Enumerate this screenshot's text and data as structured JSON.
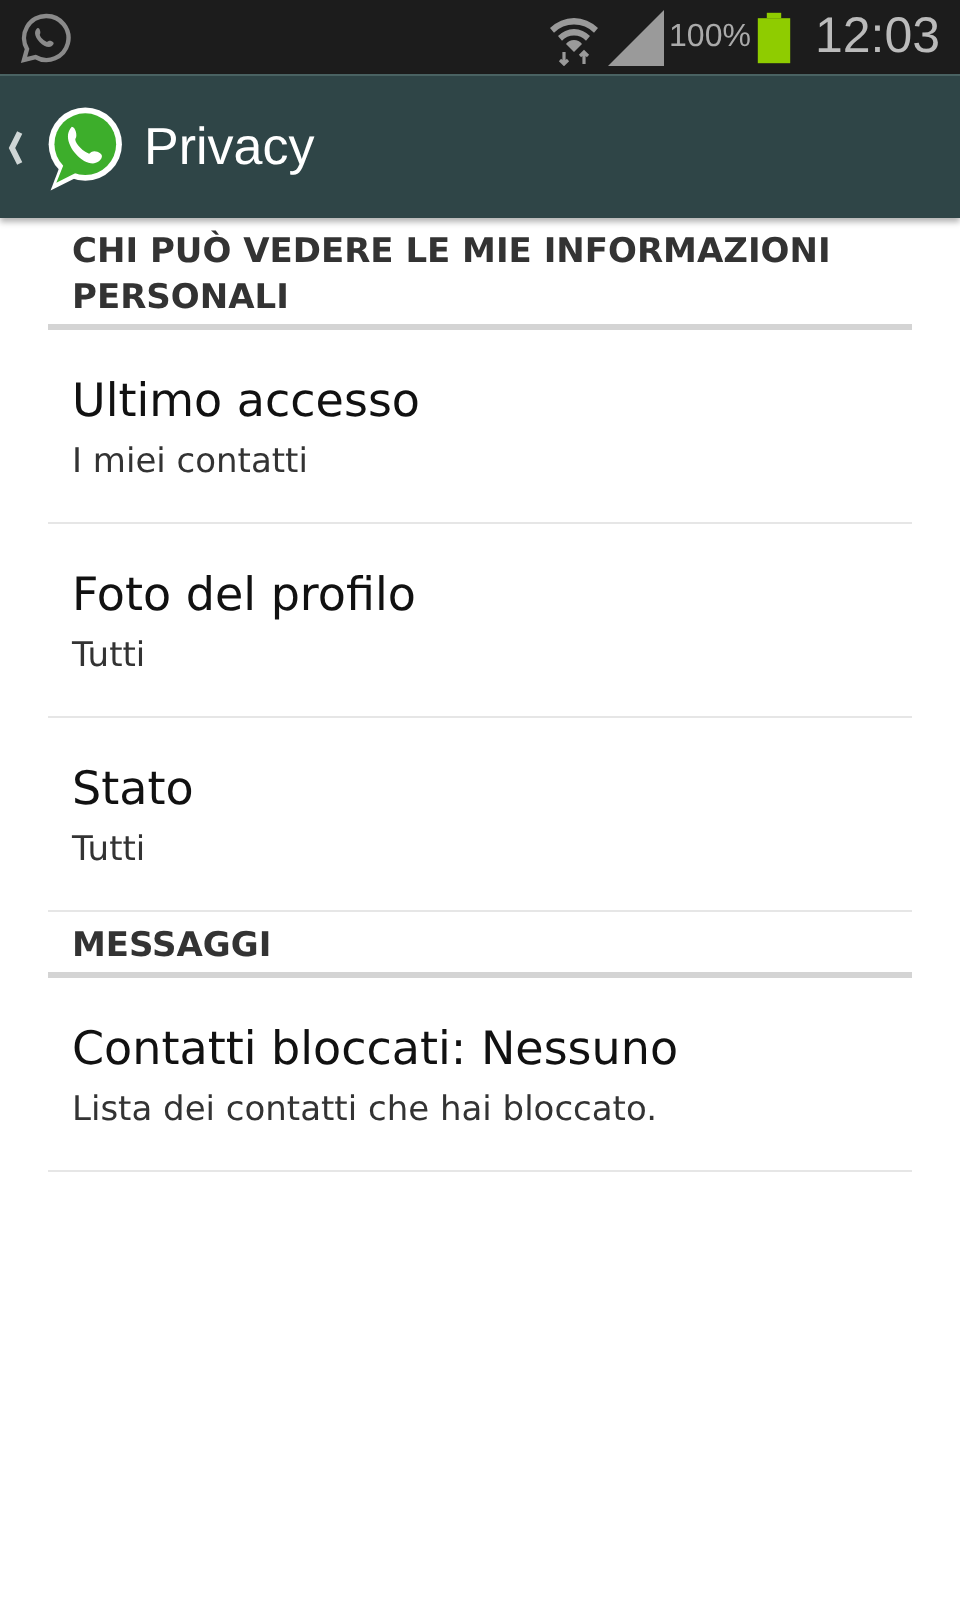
{
  "status_bar": {
    "battery": "100%",
    "time": "12:03"
  },
  "action_bar": {
    "title": "Privacy"
  },
  "sections": [
    {
      "header": "CHI PUÒ VEDERE LE MIE INFORMAZIONI PERSONALI",
      "items": [
        {
          "title": "Ultimo accesso",
          "summary": "I miei contatti"
        },
        {
          "title": "Foto del profilo",
          "summary": "Tutti"
        },
        {
          "title": "Stato",
          "summary": "Tutti"
        }
      ]
    },
    {
      "header": "MESSAGGI",
      "items": [
        {
          "title": "Contatti bloccati: Nessuno",
          "summary": "Lista dei contatti che hai bloccato."
        }
      ]
    }
  ]
}
